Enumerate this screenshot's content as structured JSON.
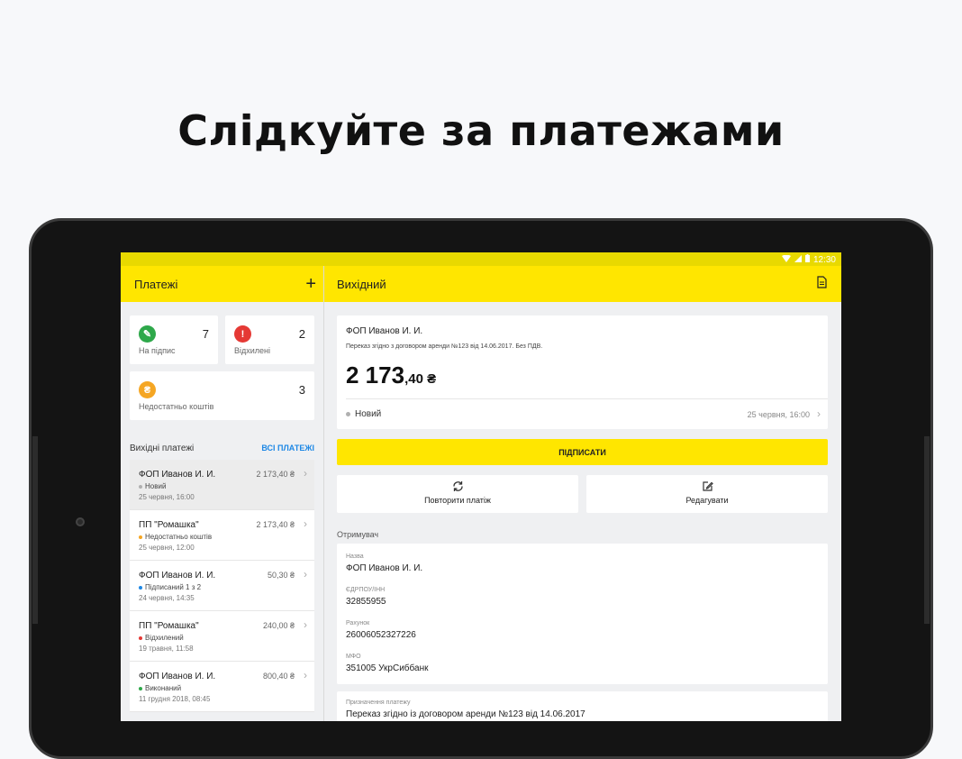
{
  "promo": {
    "headline": "Слідкуйте за платежами"
  },
  "statusbar": {
    "time": "12:30"
  },
  "left_panel": {
    "title": "Платежі",
    "add_icon": "+",
    "stats": [
      {
        "label": "На підпис",
        "count": "7",
        "color": "#2ea84a",
        "icon": "pencil-icon",
        "glyph": "✎"
      },
      {
        "label": "Відхилені",
        "count": "2",
        "color": "#e53935",
        "icon": "exclamation-icon",
        "glyph": "!"
      },
      {
        "label": "Недостатньо коштів",
        "count": "3",
        "color": "#f5a623",
        "icon": "hryvnia-icon",
        "glyph": "₴"
      }
    ],
    "section_title": "Вихідні платежі",
    "all_payments_link": "ВСІ ПЛАТЕЖІ",
    "payments": [
      {
        "name": "ФОП Иванов И. И.",
        "amount": "2 173,40 ₴",
        "status": "Новий",
        "status_color": "#b0b0b0",
        "date": "25 червня, 16:00"
      },
      {
        "name": "ПП \"Ромашка\"",
        "amount": "2 173,40 ₴",
        "status": "Недостатньо коштів",
        "status_color": "#f5a623",
        "date": "25 червня, 12:00"
      },
      {
        "name": "ФОП Иванов И. И.",
        "amount": "50,30 ₴",
        "status": "Підписаний 1 з 2",
        "status_color": "#1e88e5",
        "date": "24 червня, 14:35"
      },
      {
        "name": "ПП \"Ромашка\"",
        "amount": "240,00 ₴",
        "status": "Відхилений",
        "status_color": "#e53935",
        "date": "19 травня, 11:58"
      },
      {
        "name": "ФОП Иванов И. И.",
        "amount": "800,40 ₴",
        "status": "Виконаний",
        "status_color": "#2ea84a",
        "date": "11 грудня 2018, 08:45"
      }
    ]
  },
  "right_panel": {
    "title": "Вихідний",
    "document": {
      "payee": "ФОП Иванов И. И.",
      "purpose": "Переказ згідно з договором аренди №123 від 14.06.2017. Без ПДВ.",
      "sum_main": "2 173",
      "sum_cents": ",40 ₴",
      "state": "Новий",
      "state_date": "25 червня, 16:00"
    },
    "sign_button": "ПІДПИСАТИ",
    "repeat_button": "Повторити платіж",
    "edit_button": "Редагувати",
    "recipient_title": "Отримувач",
    "recipient": {
      "name_label": "Назва",
      "name_value": "ФОП Иванов И. И.",
      "code_label": "ЄДРПОУ/ІНН",
      "code_value": "32855955",
      "account_label": "Рахунок",
      "account_value": "26006052327226",
      "mfo_label": "МФО",
      "mfo_value": "351005 УкрСиббанк"
    },
    "purpose_block": {
      "label": "Призначення платежу",
      "value": "Переказ згідно із договором аренди №123 від 14.06.2017"
    }
  }
}
